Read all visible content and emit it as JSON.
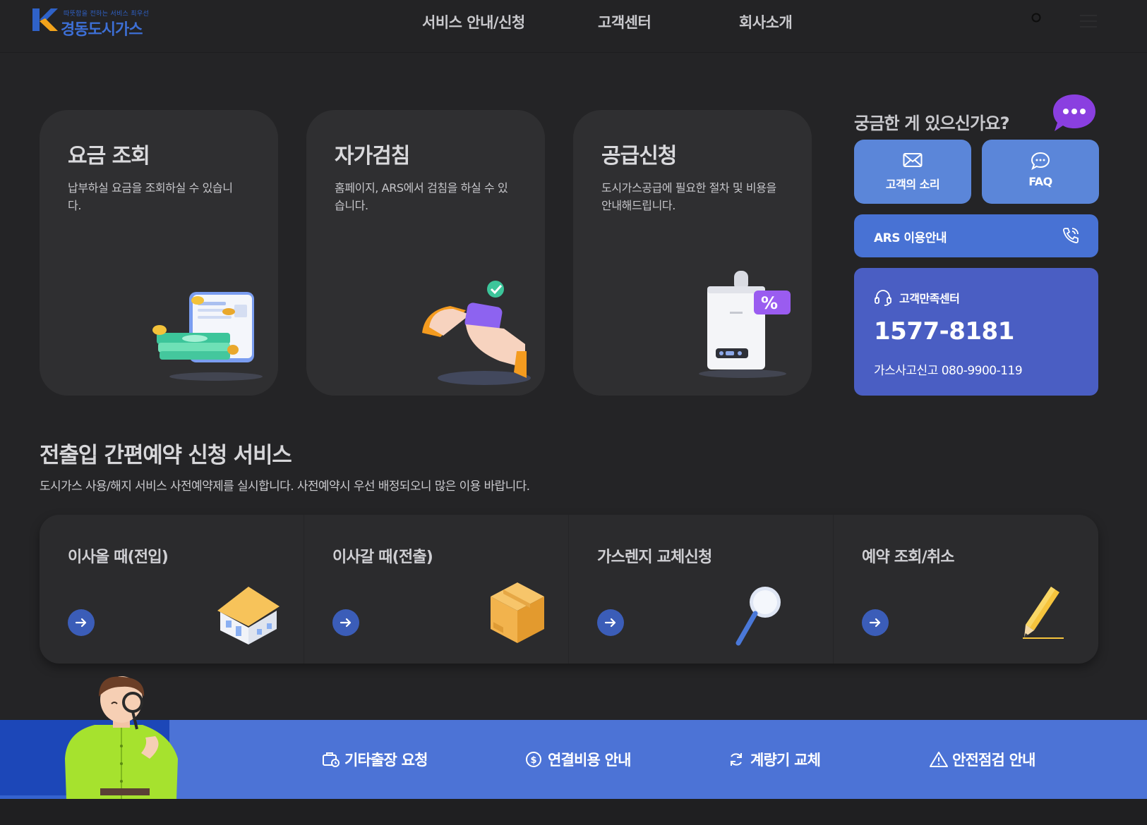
{
  "header": {
    "logo_slogan": "따뜻함을 전하는 서비스 최우선",
    "logo_name": "경동도시가스",
    "nav": [
      "서비스 안내/신청",
      "고객센터",
      "회사소개"
    ]
  },
  "cards": [
    {
      "title": "요금 조회",
      "desc": "납부하실 요금을 조회하실 수 있습니다."
    },
    {
      "title": "자가검침",
      "desc": "홈페이지, ARS에서 검침을 하실 수 있습니다."
    },
    {
      "title": "공급신청",
      "desc": "도시가스공급에 필요한 절차 및 비용을 안내해드립니다."
    }
  ],
  "sidebar": {
    "question": "궁금한 게 있으신가요?",
    "voice_label": "고객의 소리",
    "faq_label": "FAQ",
    "ars_label": "ARS 이용안내",
    "cs_label": "고객만족센터",
    "cs_phone": "1577-8181",
    "emergency": "가스사고신고 080-9900-119"
  },
  "reservation": {
    "title": "전출입 간편예약 신청 서비스",
    "desc": "도시가스 사용/해지 서비스 사전예약제를 실시합니다. 사전예약시 우선 배정되오니 많은 이용 바랍니다.",
    "items": [
      "이사올 때(전입)",
      "이사갈 때(전출)",
      "가스렌지 교체신청",
      "예약 조회/취소"
    ]
  },
  "band": {
    "links": [
      "기타출장 요청",
      "연결비용 안내",
      "계량기 교체",
      "안전점검 안내"
    ]
  },
  "colors": {
    "background": "#242426",
    "card": "#2f2f31",
    "button_light_blue": "#5b86d9",
    "ars_blue": "#4872d4",
    "cs_blue": "#4a5ec3",
    "band_blue": "#4c73d6",
    "logo_blue": "#3d6fd6"
  },
  "icons": {
    "voice": "envelope-icon",
    "faq": "chat-bubble-icon",
    "ars": "phone-icon",
    "cs": "headset-icon",
    "band": [
      "briefcase-clock-icon",
      "dollar-circle-icon",
      "refresh-icon",
      "warning-triangle-icon"
    ]
  }
}
